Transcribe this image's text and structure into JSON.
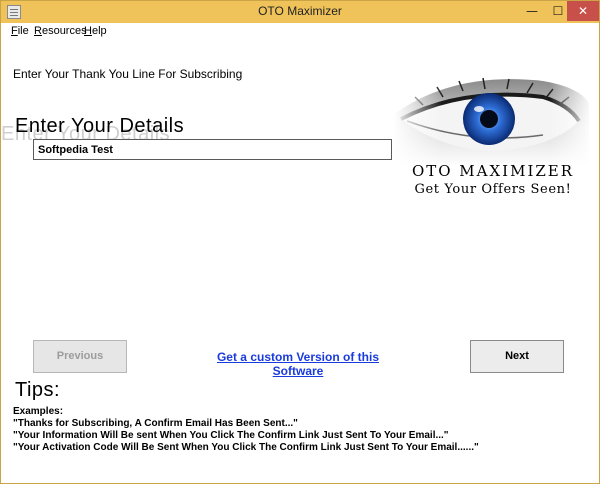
{
  "window": {
    "title": "OTO Maximizer",
    "minimize_glyph": "—",
    "maximize_glyph": "☐",
    "close_glyph": "✕",
    "app_icon": "app-window-icon"
  },
  "menu": {
    "items": [
      {
        "mnemonic": "F",
        "rest": "ile"
      },
      {
        "mnemonic": "R",
        "rest": "esources"
      },
      {
        "mnemonic": "H",
        "rest": "elp"
      }
    ]
  },
  "form": {
    "thanks_label": "Enter Your Thank You Line For Subscribing",
    "details_title": "Enter Your Details",
    "input_value": "Softpedia Test"
  },
  "brand": {
    "name": "OTO MAXIMIZER",
    "tagline": "Get Your Offers Seen!"
  },
  "buttons": {
    "previous": "Previous",
    "next": "Next"
  },
  "link": {
    "custom_version": "Get a custom Version of this Software"
  },
  "tips": {
    "title": "Tips:",
    "examples_label": "Examples:",
    "examples": [
      "\"Thanks for Subscribing, A Confirm Email Has Been Sent...\"",
      "\"Your Information Will Be sent When You Click The Confirm Link Just Sent To Your Email...\"",
      "\"Your Activation Code Will Be Sent When You Click The Confirm Link Just Sent To Your Email......\""
    ]
  },
  "colors": {
    "titlebar": "#f0c35a",
    "close_button": "#c7504a",
    "link": "#1a3bdb",
    "iris": "#2f6fd8"
  }
}
